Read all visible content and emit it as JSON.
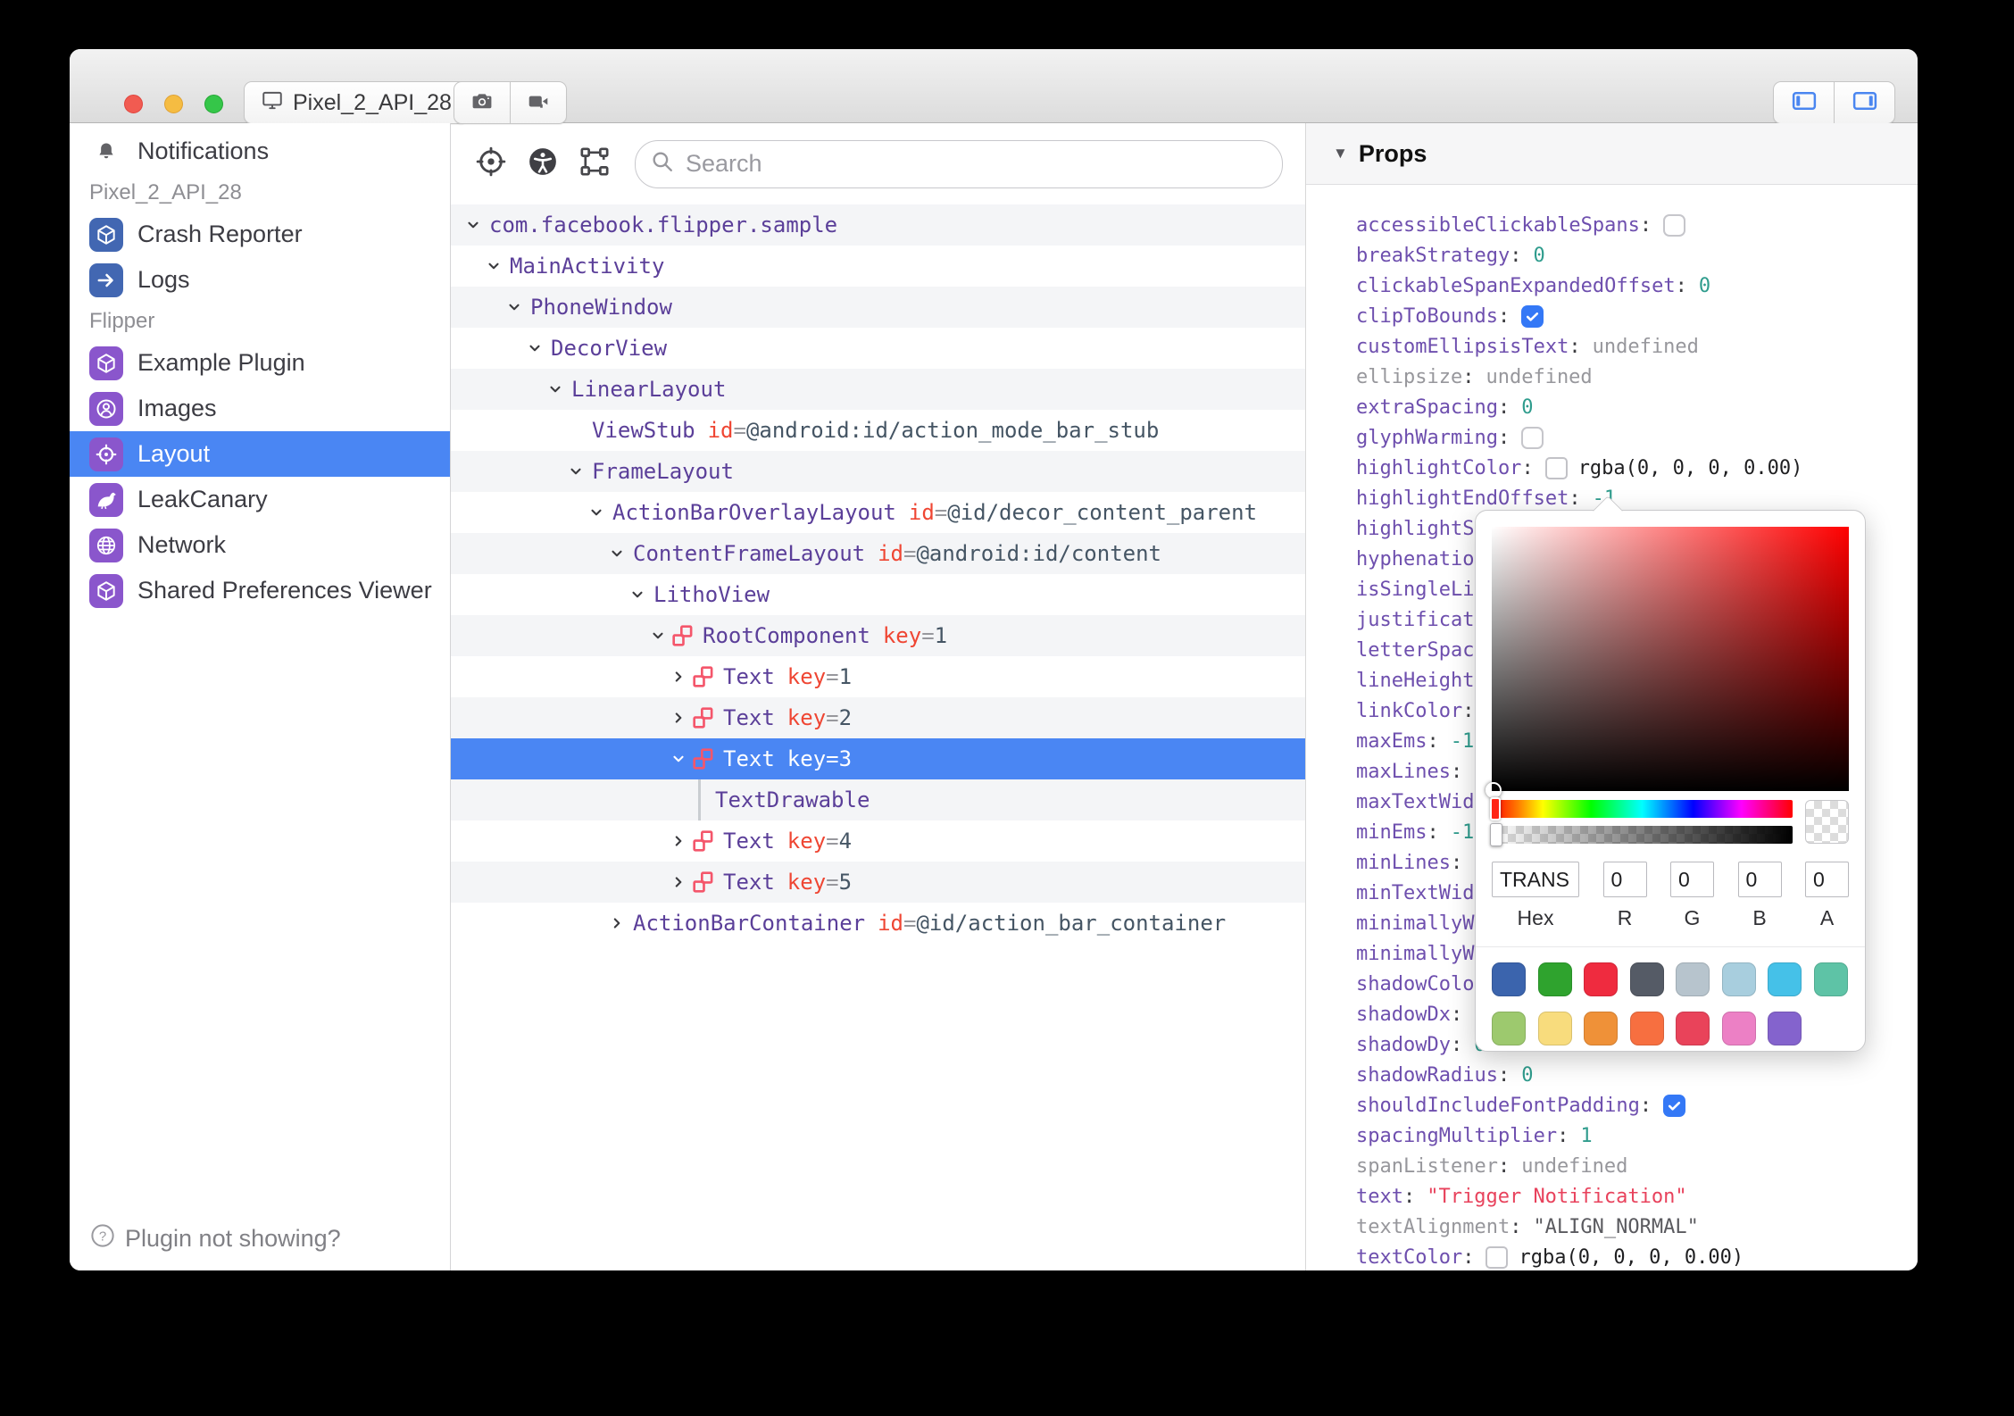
{
  "titlebar": {
    "device": "Pixel_2_API_28",
    "capture_buttons": [
      {
        "icon": "camera"
      },
      {
        "icon": "video-camera"
      }
    ],
    "panel_toggles": [
      {
        "icon": "panel-left"
      },
      {
        "icon": "panel-right"
      }
    ]
  },
  "sidebar": {
    "items": [
      {
        "type": "item",
        "id": "notifications",
        "label": "Notifications",
        "icon": "bell"
      },
      {
        "type": "section",
        "label": "Pixel_2_API_28"
      },
      {
        "type": "item",
        "id": "crash-reporter",
        "label": "Crash Reporter",
        "icon": "cube",
        "color": "#4267b2"
      },
      {
        "type": "item",
        "id": "logs",
        "label": "Logs",
        "icon": "arrow-right",
        "color": "#4267b2"
      },
      {
        "type": "section",
        "label": "Flipper"
      },
      {
        "type": "item",
        "id": "example-plugin",
        "label": "Example Plugin",
        "icon": "cube",
        "color": "#8a56cc"
      },
      {
        "type": "item",
        "id": "images",
        "label": "Images",
        "icon": "user-circle",
        "color": "#8a56cc"
      },
      {
        "type": "item",
        "id": "layout",
        "label": "Layout",
        "icon": "target",
        "color": "#8a56cc",
        "selected": true
      },
      {
        "type": "item",
        "id": "leakcanary",
        "label": "LeakCanary",
        "icon": "bird",
        "color": "#8a56cc"
      },
      {
        "type": "item",
        "id": "network",
        "label": "Network",
        "icon": "globe",
        "color": "#8a56cc"
      },
      {
        "type": "item",
        "id": "shared-preferences-viewer",
        "label": "Shared Preferences Viewer",
        "icon": "cube",
        "color": "#8a56cc"
      }
    ],
    "footer_label": "Plugin not showing?"
  },
  "center": {
    "toolbar_icons": [
      "crosshair",
      "accessibility",
      "select-nodes"
    ],
    "search_placeholder": "Search"
  },
  "tree": {
    "rows": [
      {
        "level": 0,
        "chevron": "down",
        "name": "com.facebook.flipper.sample"
      },
      {
        "level": 1,
        "chevron": "down",
        "name": "MainActivity"
      },
      {
        "level": 2,
        "chevron": "down",
        "name": "PhoneWindow"
      },
      {
        "level": 3,
        "chevron": "down",
        "name": "DecorView"
      },
      {
        "level": 4,
        "chevron": "down",
        "name": "LinearLayout"
      },
      {
        "level": 5,
        "chevron": "none",
        "name": "ViewStub",
        "attr_key": "id",
        "attr_value": "@android:id/action_mode_bar_stub"
      },
      {
        "level": 5,
        "chevron": "down",
        "name": "FrameLayout"
      },
      {
        "level": 6,
        "chevron": "down",
        "name": "ActionBarOverlayLayout",
        "attr_key": "id",
        "attr_value": "@id/decor_content_parent"
      },
      {
        "level": 7,
        "chevron": "down",
        "name": "ContentFrameLayout",
        "attr_key": "id",
        "attr_value": "@android:id/content"
      },
      {
        "level": 8,
        "chevron": "down",
        "name": "LithoView"
      },
      {
        "level": 9,
        "chevron": "down",
        "litho": true,
        "name": "RootComponent",
        "attr_key": "key",
        "attr_value": "1"
      },
      {
        "level": 10,
        "chevron": "right",
        "litho": true,
        "name": "Text",
        "attr_key": "key",
        "attr_value": "1"
      },
      {
        "level": 10,
        "chevron": "right",
        "litho": true,
        "name": "Text",
        "attr_key": "key",
        "attr_value": "2"
      },
      {
        "level": 10,
        "chevron": "down",
        "litho": true,
        "name": "Text",
        "attr_key": "key",
        "attr_value": "3",
        "selected": true
      },
      {
        "level": 11,
        "chevron": "guide",
        "name": "TextDrawable"
      },
      {
        "level": 10,
        "chevron": "right",
        "litho": true,
        "name": "Text",
        "attr_key": "key",
        "attr_value": "4"
      },
      {
        "level": 10,
        "chevron": "right",
        "litho": true,
        "name": "Text",
        "attr_key": "key",
        "attr_value": "5"
      },
      {
        "level": 7,
        "chevron": "right",
        "name": "ActionBarContainer",
        "attr_key": "id",
        "attr_value": "@id/action_bar_container"
      }
    ]
  },
  "props": {
    "title": "Props",
    "rows": [
      {
        "key": "accessibleClickableSpans",
        "type": "checkbox",
        "checked": false
      },
      {
        "key": "breakStrategy",
        "type": "number",
        "value": "0"
      },
      {
        "key": "clickableSpanExpandedOffset",
        "type": "number",
        "value": "0"
      },
      {
        "key": "clipToBounds",
        "type": "checkbox",
        "checked": true
      },
      {
        "key": "customEllipsisText",
        "type": "undefined",
        "value": "undefined"
      },
      {
        "key": "ellipsize",
        "type": "undefined",
        "value": "undefined",
        "muted": true
      },
      {
        "key": "extraSpacing",
        "type": "number",
        "value": "0"
      },
      {
        "key": "glyphWarming",
        "type": "checkbox",
        "checked": false
      },
      {
        "key": "highlightColor",
        "type": "color",
        "value": "rgba(0, 0, 0, 0.00)"
      },
      {
        "key": "highlightEndOffset",
        "type": "number",
        "value": "-1"
      },
      {
        "key": "highlightS",
        "type": "cut"
      },
      {
        "key": "hyphenatio",
        "type": "cut"
      },
      {
        "key": "isSingleLi",
        "type": "cut"
      },
      {
        "key": "justificat",
        "type": "cut"
      },
      {
        "key": "letterSpac",
        "type": "cut"
      },
      {
        "key": "lineHeight",
        "type": "cut"
      },
      {
        "key": "linkColor",
        "type": "empty"
      },
      {
        "key": "maxEms",
        "type": "number",
        "value": "-1"
      },
      {
        "key": "maxLines",
        "type": "empty"
      },
      {
        "key": "maxTextWid",
        "type": "cut"
      },
      {
        "key": "minEms",
        "type": "number",
        "value": "-1"
      },
      {
        "key": "minLines",
        "type": "empty"
      },
      {
        "key": "minTextWid",
        "type": "cut"
      },
      {
        "key": "minimallyW",
        "type": "cut"
      },
      {
        "key": "minimallyW",
        "type": "cut"
      },
      {
        "key": "shadowColo",
        "type": "cut"
      },
      {
        "key": "shadowDx",
        "type": "empty"
      },
      {
        "key": "shadowDy",
        "type": "number",
        "value": "0"
      },
      {
        "key": "shadowRadius",
        "type": "number",
        "value": "0"
      },
      {
        "key": "shouldIncludeFontPadding",
        "type": "checkbox",
        "checked": true
      },
      {
        "key": "spacingMultiplier",
        "type": "number",
        "value": "1"
      },
      {
        "key": "spanListener",
        "type": "undefined",
        "value": "undefined",
        "muted": true
      },
      {
        "key": "text",
        "type": "string",
        "value": "\"Trigger Notification\"",
        "color": "red"
      },
      {
        "key": "textAlignment",
        "type": "string",
        "value": "\"ALIGN_NORMAL\"",
        "color": "dark",
        "muted": true
      },
      {
        "key": "textColor",
        "type": "color",
        "value": "rgba(0, 0, 0, 0.00)"
      }
    ]
  },
  "picker": {
    "hex": "TRANS",
    "r": "0",
    "g": "0",
    "b": "0",
    "a": "0",
    "labels": {
      "hex": "Hex",
      "r": "R",
      "g": "G",
      "b": "B",
      "a": "A"
    },
    "palette": [
      [
        "#3b64ad",
        "#2fa32e",
        "#ef2b3f",
        "#555b66",
        "#b7c4cd",
        "#a8cede",
        "#45c1e8",
        "#5ec3a6"
      ],
      [
        "#9dc96e",
        "#f8dc7d",
        "#ef9138",
        "#f76f40",
        "#e9435a",
        "#ec80c5",
        "#8463cd"
      ]
    ]
  },
  "colors": {
    "selection_blue": "#4a86f3",
    "plugin_purple": "#8a56cc",
    "plugin_blue": "#4267b2",
    "litho_pink": "#f4566b",
    "checkbox_blue": "#3478f6",
    "prop_key_purple": "#6e4fae",
    "number_teal": "#2f9c8d",
    "string_red": "#e8425c",
    "tree_name_purple": "#5b3f99",
    "attr_red": "#ef4633"
  }
}
